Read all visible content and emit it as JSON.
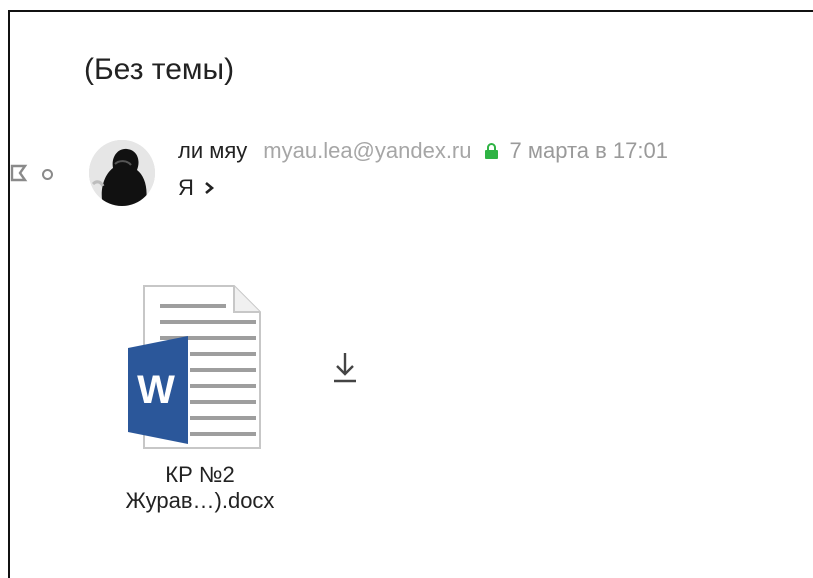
{
  "message": {
    "subject": "(Без темы)",
    "sender_name": "ли мяу",
    "sender_email": "myau.lea@yandex.ru",
    "date": "7 марта в 17:01",
    "recipient": "Я"
  },
  "attachment": {
    "name_line1": "КР №2",
    "name_line2": "Журав…).docx",
    "file_icon": "word-document-icon"
  },
  "icons": {
    "flag": "flag-icon",
    "read_status": "read-status-icon",
    "lock": "lock-icon",
    "chevron": "chevron-right-icon",
    "download": "download-icon"
  },
  "colors": {
    "word_blue": "#2b579a",
    "secure_green": "#2fb344",
    "email_gray": "#a6a6a6"
  }
}
